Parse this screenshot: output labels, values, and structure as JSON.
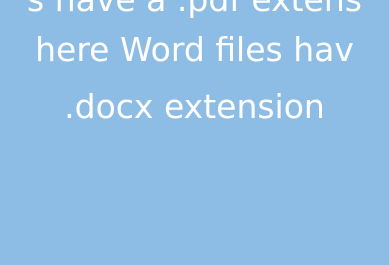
{
  "caption": {
    "line_1": "s have a .pdf extens",
    "line_2": "here Word files hav",
    "line_3": ".docx extension"
  },
  "colors": {
    "background": "#8dbde4",
    "text": "#ffffff"
  }
}
